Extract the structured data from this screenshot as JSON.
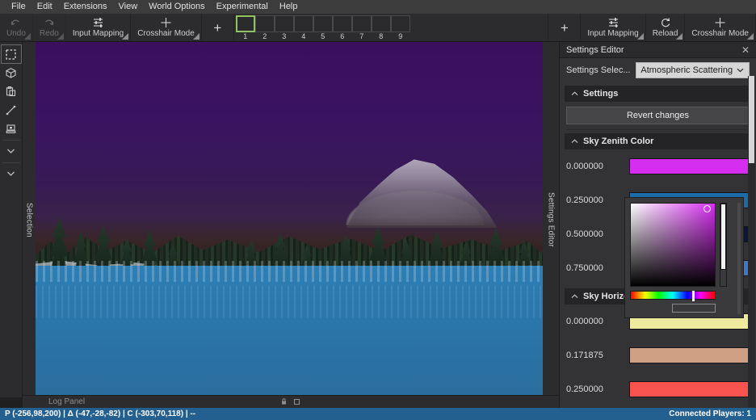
{
  "menubar": {
    "items": [
      {
        "label": "File"
      },
      {
        "label": "Edit"
      },
      {
        "label": "Extensions"
      },
      {
        "label": "View"
      },
      {
        "label": "World Options"
      },
      {
        "label": "Experimental"
      },
      {
        "label": "Help"
      }
    ]
  },
  "toolbar_left": {
    "undo": {
      "label": "Undo",
      "icon": "undo-arrow-icon",
      "disabled": true
    },
    "redo": {
      "label": "Redo",
      "icon": "redo-arrow-icon",
      "disabled": true
    },
    "input_mapping": {
      "label": "Input Mapping",
      "icon": "sliders-icon"
    },
    "crosshair_mode": {
      "label": "Crosshair Mode",
      "icon": "crosshair-icon"
    },
    "add": {
      "label": "+",
      "icon": "plus-icon"
    }
  },
  "toolbar_right": {
    "add": {
      "label": "+",
      "icon": "plus-icon"
    },
    "input_mapping": {
      "label": "Input Mapping",
      "icon": "sliders-icon"
    },
    "reload": {
      "label": "Reload",
      "icon": "reload-icon"
    },
    "crosshair_mode": {
      "label": "Crosshair Mode",
      "icon": "crosshair-icon"
    }
  },
  "hotbar": {
    "selected_index": 1,
    "slots": [
      {
        "number": "1"
      },
      {
        "number": "2"
      },
      {
        "number": "3"
      },
      {
        "number": "4"
      },
      {
        "number": "5"
      },
      {
        "number": "6"
      },
      {
        "number": "7"
      },
      {
        "number": "8"
      },
      {
        "number": "9"
      }
    ]
  },
  "tool_rail": {
    "tools": [
      {
        "icon": "selection-marquee-icon",
        "active": true
      },
      {
        "icon": "cube-icon",
        "active": false
      },
      {
        "icon": "paste-clipboard-icon",
        "active": false
      },
      {
        "icon": "line-tool-icon",
        "active": false
      },
      {
        "icon": "stamp-icon",
        "active": false
      },
      {
        "icon": "chevron-down-icon",
        "active": false
      },
      {
        "icon": "chevron-down-icon-2",
        "active": false
      }
    ]
  },
  "vertical_tabs": {
    "selection": "Selection",
    "settings_editor": "Settings Editor"
  },
  "viewport_bottom": {
    "log_panel_label": "Log Panel",
    "pin_icon": "pin-icon",
    "maximize_icon": "maximize-icon"
  },
  "panel": {
    "title": "Settings Editor",
    "close_icon": "close-icon",
    "settings_selector": {
      "label": "Settings Selec...",
      "value": "Atmospheric Scattering",
      "chevron": "chevron-down-icon"
    },
    "settings_group": {
      "label": "Settings",
      "collapsed": false
    },
    "revert_button": "Revert changes",
    "sky_zenith_color": {
      "label": "Sky Zenith Color",
      "stops": [
        {
          "position": "0.000000",
          "color": "#d62ef0"
        },
        {
          "position": "0.250000",
          "color": "#1d6aa8"
        },
        {
          "position": "0.500000",
          "color": "#0d1638"
        },
        {
          "position": "0.750000",
          "color": "#3f78c8"
        }
      ]
    },
    "sky_horizon": {
      "label": "Sky Horizon",
      "stops": [
        {
          "position": "0.000000",
          "color": "#eeea9e"
        },
        {
          "position": "0.171875",
          "color": "#cfa084"
        },
        {
          "position": "0.250000",
          "color": "#f9534f"
        }
      ]
    }
  },
  "color_picker": {
    "hue_color": "#d62ef0",
    "visible": true
  },
  "statusbar": {
    "left": "P (-256,98,200) | Δ (-47,-28,-82) | C (-303,70,118) | --",
    "right": "Connected Players: 1"
  }
}
